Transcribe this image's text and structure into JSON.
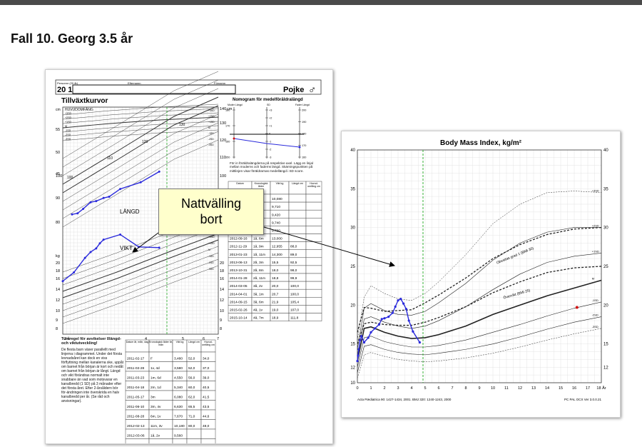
{
  "slide": {
    "title": "Fall 10. Georg 3.5 år"
  },
  "growth_chart": {
    "header": {
      "label_personnr": "Personnr (20 år)",
      "label_efternamn": "Efternamn",
      "label_fornamn": "Förnamn",
      "personnr_value": "20 11",
      "sex_value": "Pojke",
      "sex_symbol": "♂"
    },
    "title": "Tillväxtkurvor",
    "head_section": "HUVUDOMFÅNG",
    "head_unit": "cm",
    "head_sd_labels": [
      "+3SD",
      "+2SD",
      "+1SD",
      "M",
      "-1SD",
      "-2SD",
      "-3SD"
    ],
    "left_axis_head": [
      "55",
      "50",
      "45"
    ],
    "left_axis_length": [
      "100",
      "90",
      "80"
    ],
    "left_axis_weight_unit": "kg",
    "left_axis_weight": [
      "20",
      "18",
      "16",
      "14",
      "12",
      "10",
      "9",
      "8"
    ],
    "right_axis_length": [
      "140",
      "130",
      "120",
      "110",
      "100"
    ],
    "right_axis_length_unit": "cm",
    "right_axis_weight": [
      "20",
      "18",
      "16",
      "14",
      "12",
      "10",
      "9",
      "8"
    ],
    "curve_labels_inner": [
      "110",
      "120",
      "130",
      "100"
    ],
    "x_axis_labels": [
      "2 år",
      "3",
      "4",
      "5",
      "6",
      "7"
    ],
    "label_langd": "LÄNGD",
    "label_vikt": "VIKT",
    "nomogram": {
      "title": "Nomogram för medelföräldralängd",
      "col_mother": "Moder Längd",
      "col_sd": "SD",
      "col_father": "Fader Längd",
      "mother_ticks": [
        "180",
        "170",
        "160",
        "150"
      ],
      "sd_ticks": [
        "+3",
        "+2",
        "+1",
        "0",
        "-1",
        "-2",
        "-3"
      ],
      "father_ticks": [
        "200",
        "190",
        "180",
        "170",
        "160"
      ],
      "note": "För in föräldralängderna på respektive axel. Lägg en linjal mellan moderns och faderns längd. Skärningspunkten på mittlinjen visar föräldrarnas medellängd i SD score."
    },
    "table_top": {
      "headers": [
        "Datum",
        "Kronologisk ålder",
        "Vikt kg",
        "Längd cm",
        "Huvud-omfång cm"
      ],
      "rows": [
        [
          "",
          "",
          "10,080",
          "",
          ""
        ],
        [
          "",
          "",
          "9,710",
          "",
          ""
        ],
        [
          "",
          "",
          "9,420",
          "",
          ""
        ],
        [
          "",
          "",
          "9,740",
          "",
          ""
        ],
        [
          "",
          "",
          "9,730",
          "",
          ""
        ],
        [
          "2012-09-16",
          "1å, 6m",
          "13,000",
          "",
          ""
        ],
        [
          "2012-11-29",
          "1å, 9m",
          "12,955",
          "88,0",
          ""
        ],
        [
          "2013-01-23",
          "1å, 11m",
          "14,300",
          "89,0",
          ""
        ],
        [
          "2013-06-13",
          "2å, 3m",
          "15,5",
          "92,5",
          ""
        ],
        [
          "2013-10-31",
          "2å, 8m",
          "18,0",
          "98,0",
          ""
        ],
        [
          "2014-01-28",
          "2å, 11m",
          "18,8",
          "99,9",
          ""
        ],
        [
          "2014-03-05",
          "3å, 2v",
          "20,0",
          "100,0",
          ""
        ],
        [
          "2014-04-01",
          "3å, 1m",
          "20,7",
          "100,0",
          ""
        ],
        [
          "2014-09-15",
          "3å, 6m",
          "21,9",
          "105,4",
          ""
        ],
        [
          "2015-02-26",
          "4å, 1v",
          "19,0",
          "107,0",
          ""
        ],
        [
          "2015-10-14",
          "4å, 7m",
          "18,9",
          "111,8",
          ""
        ]
      ]
    },
    "rules": {
      "title": "Tumregel för avvikelser i längd- och viktutveckling!",
      "body": "De flesta barn växer parallellt med linjerna i diagrammet. Under det första levnadsåret kan dock en viss förflyttning mellan kanalerna ske, uppåt om barnet från början är kort och nedåt om barnet från början är långt. Längd och vikt förändras normalt inte snabbare än vad som motsvarar en kanalbredd (1 SD) på 3 månader efter det första året. Efter 2-årsåldern bör för-ändringen inte överskrida en halv kanalbredd per år. (Se råd och anvisningar)."
    },
    "table_bottom": {
      "headers": [
        "Datum år, mån, dag",
        "Kronologisk ålder år, mån",
        "Vikt kg",
        "Längd cm",
        "Huvud-omfång cm"
      ],
      "rows": [
        [
          "2011-02-17",
          "F",
          "3,480",
          "52,0",
          "34,0"
        ],
        [
          "2011-02-28",
          "1v, 4d",
          "3,580",
          "52,0",
          "37,0"
        ],
        [
          "2011-03-23",
          "1m, 6d",
          "4,550",
          "56,0",
          "39,0"
        ],
        [
          "2011-04-18",
          "2m, 1d",
          "5,340",
          "60,0",
          "40,5"
        ],
        [
          "2011-05-17",
          "3m",
          "6,080",
          "62,0",
          "41,5"
        ],
        [
          "2011-06-10",
          "3m, 4v",
          "6,630",
          "65,5",
          "43,5"
        ],
        [
          "2011-08-28",
          "6m, 1v",
          "7,670",
          "71,0",
          "44,6"
        ],
        [
          "2012-02-13",
          "11m, 3v",
          "10,180",
          "80,0",
          "48,0"
        ],
        [
          "2012-03-06",
          "1å, 2v",
          "9,560",
          "",
          ""
        ],
        [
          "2012-03-09",
          "1å, 3v",
          "9,500",
          "",
          ""
        ]
      ]
    }
  },
  "callout": {
    "line1": "Nattvälling",
    "line2": "bort"
  },
  "bmi_chart": {
    "title": "Body Mass Index, kg/m²",
    "y_ticks_left": [
      "40",
      "35",
      "30",
      "25",
      "20",
      "15",
      "12",
      "10"
    ],
    "y_ticks_right": [
      "40",
      "35",
      "30",
      "25",
      "20",
      "15",
      "12"
    ],
    "x_ticks": [
      "0",
      "1",
      "2",
      "3",
      "4",
      "5",
      "6",
      "7",
      "8",
      "9",
      "10",
      "11",
      "12",
      "13",
      "14",
      "15",
      "16",
      "17",
      "18 År"
    ],
    "curve_labels": [
      "+3SD",
      "+2SD",
      "+1SD",
      "M",
      "-1SD",
      "-2SD",
      "-3SD"
    ],
    "obesity_label": "Obesitas grad 1 (BMI 30)",
    "overweight_label": "Övervikt (BMI 25)",
    "footer_left": "Acta Pædiatrica 90: 1427-1434, 2001.  BMJ 320: 1240-1243, 2000",
    "footer_right": "PC PAL OCX Ver 3.0.0.21",
    "colors": {
      "patient_line": "#2a2adb",
      "marker_red": "#d11111",
      "reference_green": "#22aa22"
    }
  },
  "chart_data": [
    {
      "type": "line",
      "title": "Tillväxtkurvor",
      "xlabel": "",
      "ylabel": "",
      "series": [
        {
          "name": "LÄNGD",
          "x": [
            2.25,
            2.4,
            2.55,
            2.75,
            2.9,
            3.1,
            3.25,
            3.55,
            4.1,
            4.6
          ],
          "values": [
            92.5,
            93,
            95,
            98,
            98.5,
            99.9,
            100.5,
            104,
            107,
            111.8
          ]
        },
        {
          "name": "VIKT",
          "x": [
            2.0,
            2.3,
            2.6,
            2.75,
            2.9,
            3.0,
            3.1,
            3.55,
            4.05,
            4.6
          ],
          "values": [
            14.3,
            15.5,
            17.5,
            18.3,
            18.8,
            19.5,
            20,
            20.7,
            19,
            18.9
          ]
        }
      ]
    },
    {
      "type": "line",
      "title": "Body Mass Index, kg/m²",
      "xlabel": "År",
      "ylabel": "",
      "ylim": [
        10,
        40
      ],
      "xlim": [
        0,
        18
      ],
      "series": [
        {
          "x": [
            0,
            0.05,
            0.1,
            0.2,
            0.3,
            0.5,
            0.8,
            1.0,
            1.3,
            1.6,
            1.8,
            2.0,
            2.3,
            2.6,
            2.8,
            3.0,
            3.2,
            3.4,
            3.6,
            3.8,
            4.1,
            4.6
          ],
          "values": [
            12.8,
            13.5,
            14.3,
            15.5,
            16.0,
            15.2,
            15.8,
            16.5,
            17.0,
            17.5,
            18.2,
            18.3,
            18.5,
            19.0,
            19.8,
            20.6,
            20.8,
            20.2,
            19.5,
            18.0,
            16.6,
            15.2
          ]
        }
      ]
    }
  ]
}
